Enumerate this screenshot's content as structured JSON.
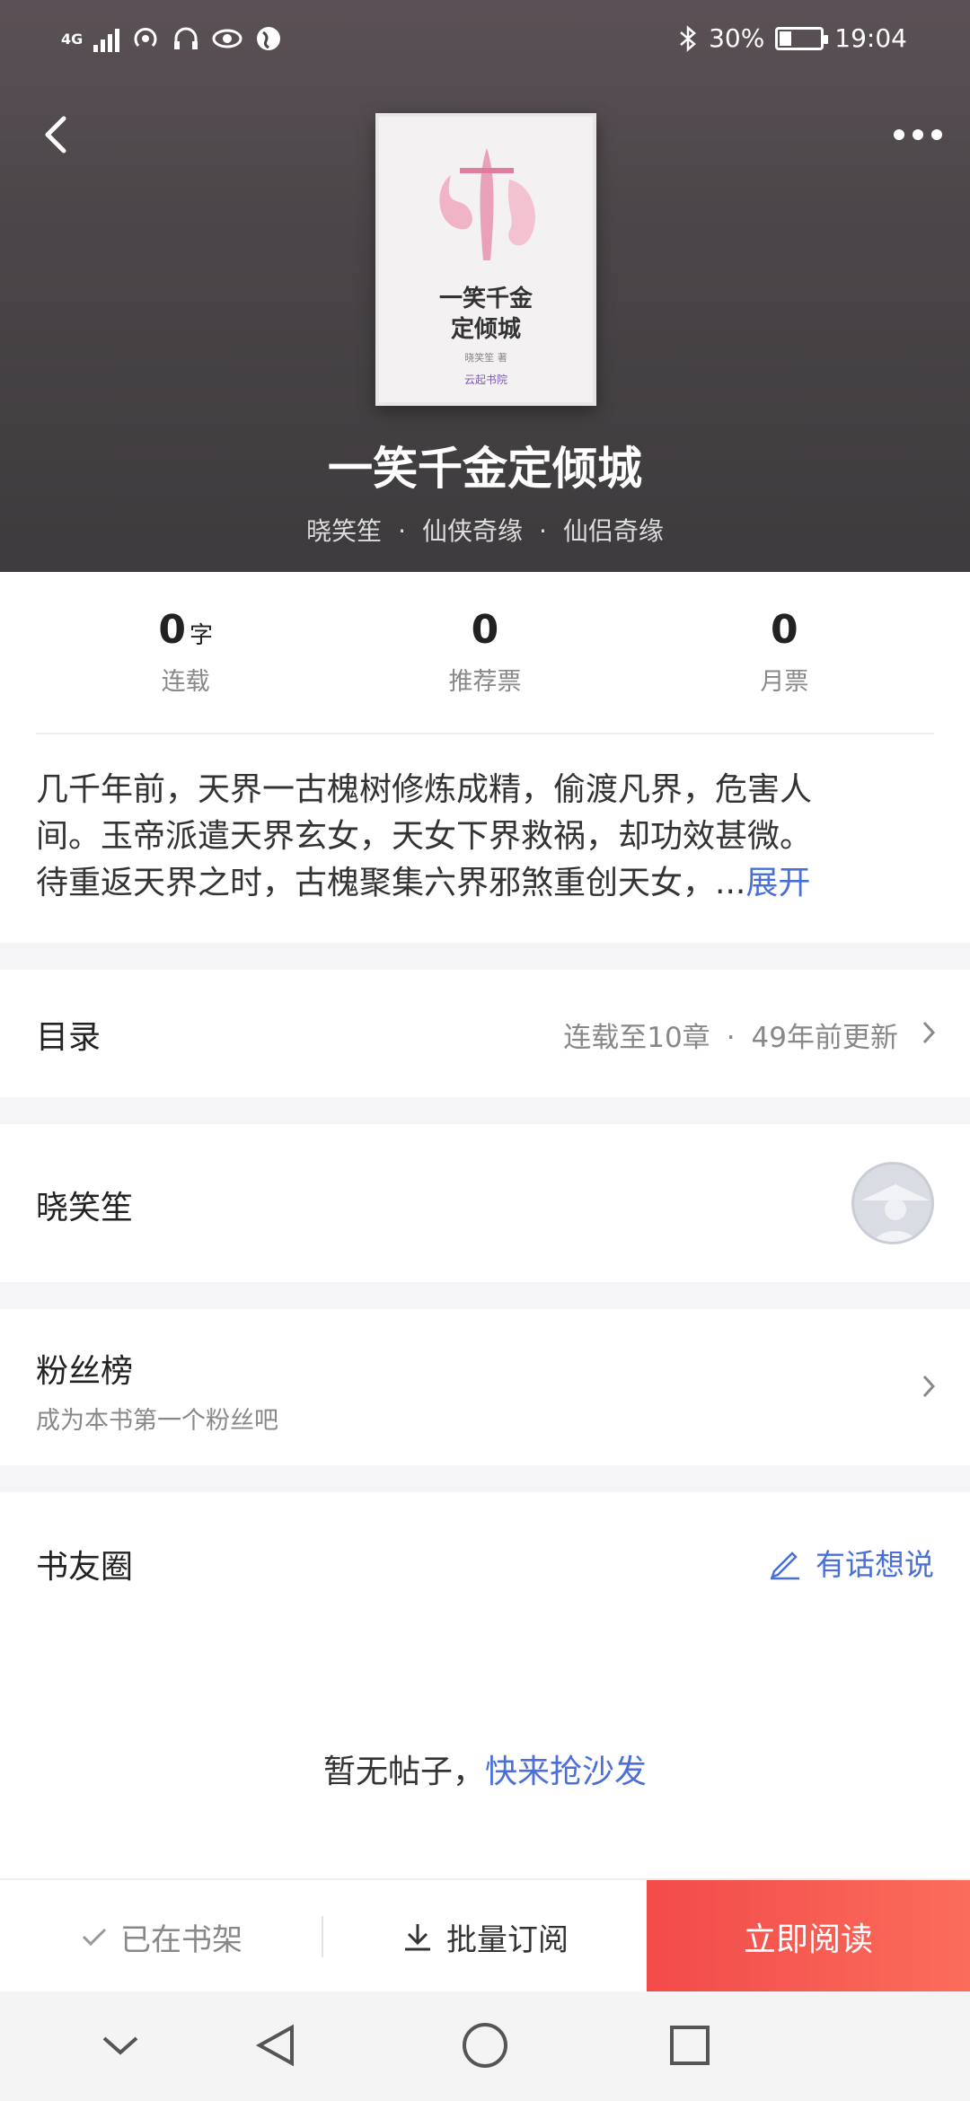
{
  "status_bar": {
    "network": "4G",
    "battery": "30%",
    "battery_level": 0.3,
    "time": "19:04",
    "icons": [
      "signal-icon",
      "hotspot-icon",
      "headphones-icon",
      "eye-icon",
      "globe-icon",
      "bluetooth-icon",
      "battery-icon"
    ]
  },
  "header": {
    "back_icon": "back-icon",
    "more_icon": "more-icon",
    "cover": {
      "title_line1": "一笑千金",
      "title_line2": "定倾城",
      "author": "晓笑笙 著",
      "publisher": "云起书院"
    },
    "title": "一笑千金定倾城",
    "author": "晓笑笙",
    "category": "仙侠奇缘",
    "subcategory": "仙侣奇缘",
    "dot": "·"
  },
  "stats": [
    {
      "value": "0",
      "unit": "字",
      "label": "连载"
    },
    {
      "value": "0",
      "unit": "",
      "label": "推荐票"
    },
    {
      "value": "0",
      "unit": "",
      "label": "月票"
    }
  ],
  "description": {
    "line1": "几千年前，天界一古槐树修炼成精，偷渡凡界，危害人",
    "line2": "间。玉帝派遣天界玄女，天女下界救祸，却功效甚微。",
    "line3": "待重返天界之时，古槐聚集六界邪煞重创天女，...",
    "expand": "展开"
  },
  "catalog": {
    "title": "目录",
    "status": "连载至10章",
    "dot": "·",
    "updated": "49年前更新"
  },
  "author_row": {
    "name": "晓笑笙"
  },
  "fans": {
    "title": "粉丝榜",
    "subtitle": "成为本书第一个粉丝吧"
  },
  "circle": {
    "title": "书友圈",
    "action": "有话想说",
    "empty": "暂无帖子，",
    "empty_link": "快来抢沙发"
  },
  "bottom_bar": {
    "shelf": "已在书架",
    "subscribe": "批量订阅",
    "read": "立即阅读"
  },
  "colors": {
    "accent": "#4a6fd8",
    "read_button": "#f24a4a",
    "header_bg": "#4a4548"
  }
}
